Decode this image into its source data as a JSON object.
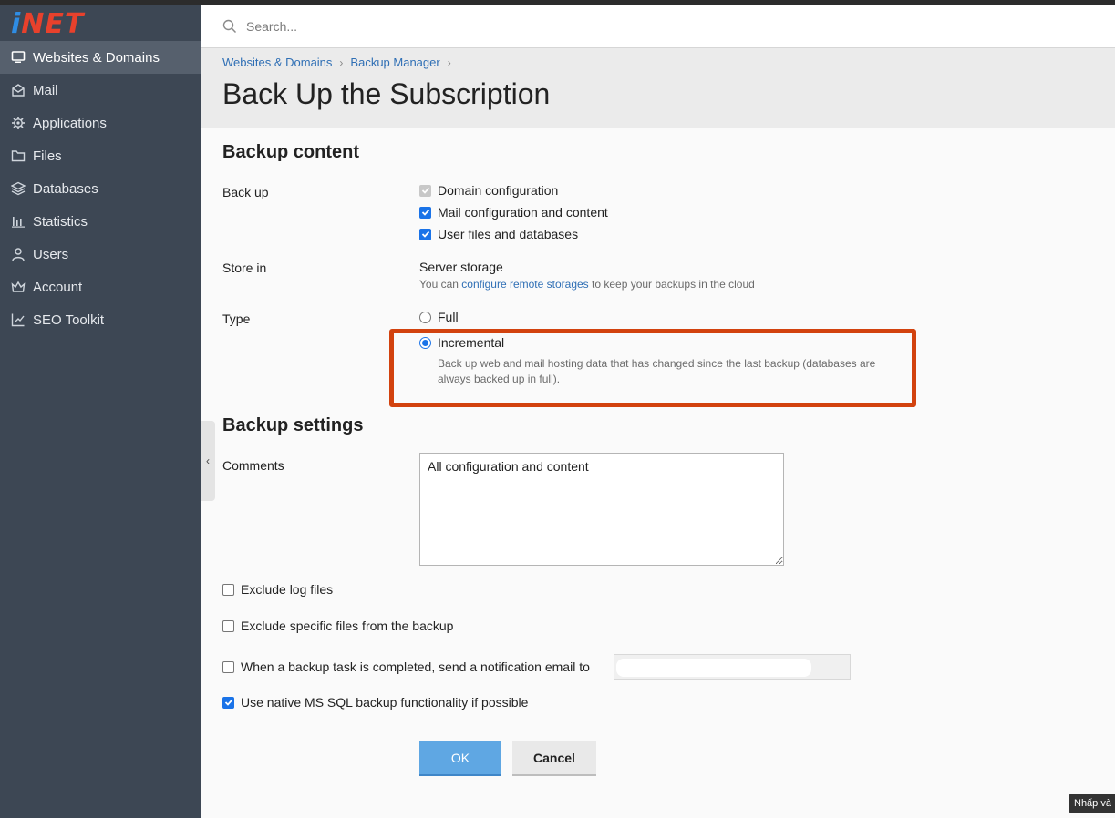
{
  "brand": {
    "logo_text_a": "i",
    "logo_text_b": "NET"
  },
  "colors": {
    "sidebar": "#3d4754",
    "accent": "#1a73e8",
    "highlight": "#d2420e",
    "link": "#2f6fb5"
  },
  "search": {
    "placeholder": "Search..."
  },
  "sidebar": {
    "items": [
      {
        "label": "Websites & Domains",
        "icon": "monitor-icon"
      },
      {
        "label": "Mail",
        "icon": "envelope-icon"
      },
      {
        "label": "Applications",
        "icon": "gear-icon"
      },
      {
        "label": "Files",
        "icon": "folder-icon"
      },
      {
        "label": "Databases",
        "icon": "layers-icon"
      },
      {
        "label": "Statistics",
        "icon": "bar-chart-icon"
      },
      {
        "label": "Users",
        "icon": "user-icon"
      },
      {
        "label": "Account",
        "icon": "crown-icon"
      },
      {
        "label": "SEO Toolkit",
        "icon": "chart-up-icon"
      }
    ]
  },
  "breadcrumb": {
    "items": [
      "Websites & Domains",
      "Backup Manager"
    ],
    "sep": "›"
  },
  "page": {
    "title": "Back Up the Subscription"
  },
  "backup_content": {
    "title": "Backup content",
    "backup_label": "Back up",
    "options": [
      {
        "label": "Domain configuration",
        "state": "checked-disabled"
      },
      {
        "label": "Mail configuration and content",
        "state": "checked"
      },
      {
        "label": "User files and databases",
        "state": "checked"
      }
    ],
    "store_label": "Store in",
    "store_value": "Server storage",
    "store_hint_pre": "You can ",
    "store_hint_link": "configure remote storages",
    "store_hint_post": " to keep your backups in the cloud",
    "type_label": "Type",
    "type_full": "Full",
    "type_incremental": "Incremental",
    "type_selected": "Incremental",
    "incremental_hint": "Back up web and mail hosting data that has changed since the last backup (databases are always backed up in full)."
  },
  "backup_settings": {
    "title": "Backup settings",
    "comments_label": "Comments",
    "comments_value": "All configuration and content",
    "exclude_logs": "Exclude log files",
    "exclude_specific": "Exclude specific files from the backup",
    "notify_email": "When a backup task is completed, send a notification email to",
    "native_mssql": "Use native MS SQL backup functionality if possible"
  },
  "buttons": {
    "ok": "OK",
    "cancel": "Cancel"
  },
  "tooltip": {
    "text": "Nhấp và"
  }
}
